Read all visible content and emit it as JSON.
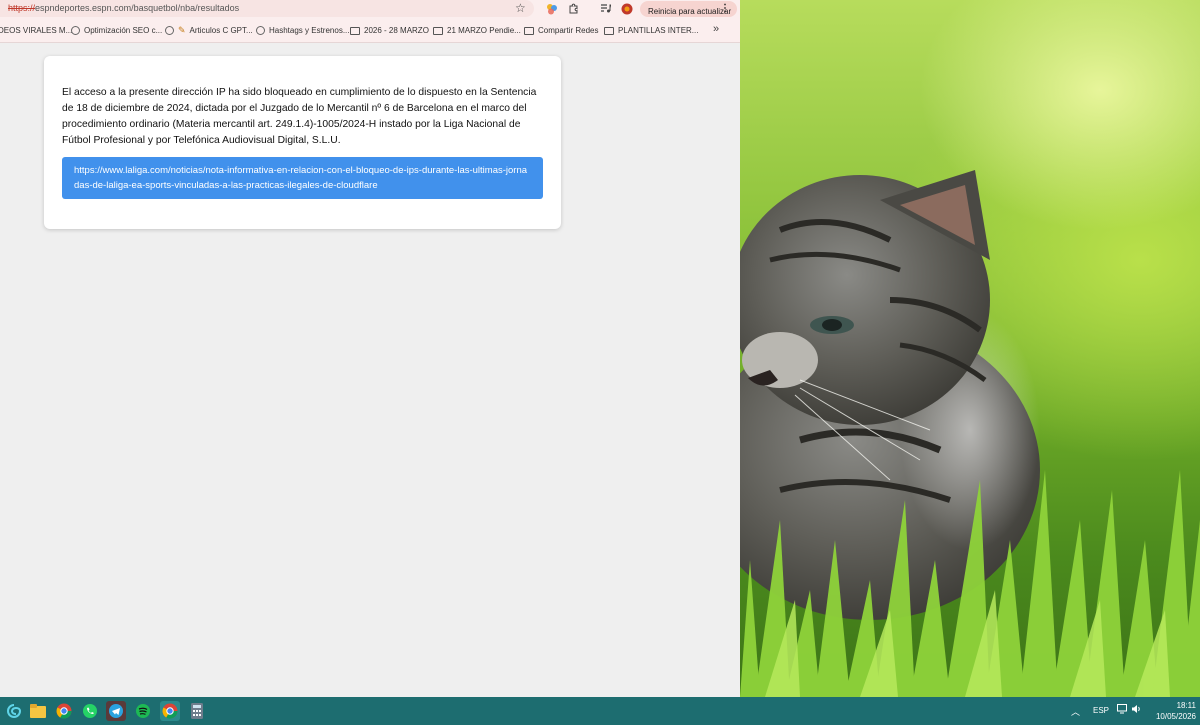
{
  "browser": {
    "url_scheme": "https://",
    "url_rest": "espndeportes.espn.com/basquetbol/nba/resultados",
    "restart_button": "Reinicia para actualizar",
    "bookmarks": [
      {
        "label": "DEOS VIRALES M...",
        "icon": "globe-icon"
      },
      {
        "label": "Optimización SEO c...",
        "icon": "globe-icon"
      },
      {
        "label": "Articulos C GPT...",
        "icon": "pencil-icon"
      },
      {
        "label": "Hashtags y Estrenos...",
        "icon": "globe-icon"
      },
      {
        "label": "2026 - 28 MARZO",
        "icon": "folder-icon"
      },
      {
        "label": "21 MARZO Pendie...",
        "icon": "folder-icon"
      },
      {
        "label": "Compartir Redes",
        "icon": "folder-icon"
      },
      {
        "label": "PLANTILLAS INTER...",
        "icon": "folder-icon"
      }
    ]
  },
  "notice": {
    "text": "El acceso a la presente dirección IP ha sido bloqueado en cumplimiento de lo dispuesto en la Sentencia de 18 de diciembre de 2024, dictada por el Juzgado de lo Mercantil nº 6 de Barcelona en el marco del procedimiento ordinario (Materia mercantil art. 249.1.4)-1005/2024-H instado por la Liga Nacional de Fútbol Profesional y por Telefónica Audiovisual Digital, S.L.U.",
    "link": "https://www.laliga.com/noticias/nota-informativa-en-relacion-con-el-bloqueo-de-ips-durante-las-ultimas-jornadas-de-laliga-ea-sports-vinculadas-a-las-practicas-ilegales-de-cloudflare"
  },
  "taskbar": {
    "language": "ESP",
    "time": "18:11",
    "date": "10/05/2026",
    "apps": [
      "edge-icon",
      "file-explorer-icon",
      "chrome-icon",
      "whatsapp-icon",
      "telegram-icon",
      "spotify-icon",
      "chrome-profile-icon",
      "calculator-icon"
    ]
  },
  "colors": {
    "link_box": "#4191ec",
    "taskbar": "#1d6d70",
    "restart_button": "#f6d4d0"
  }
}
